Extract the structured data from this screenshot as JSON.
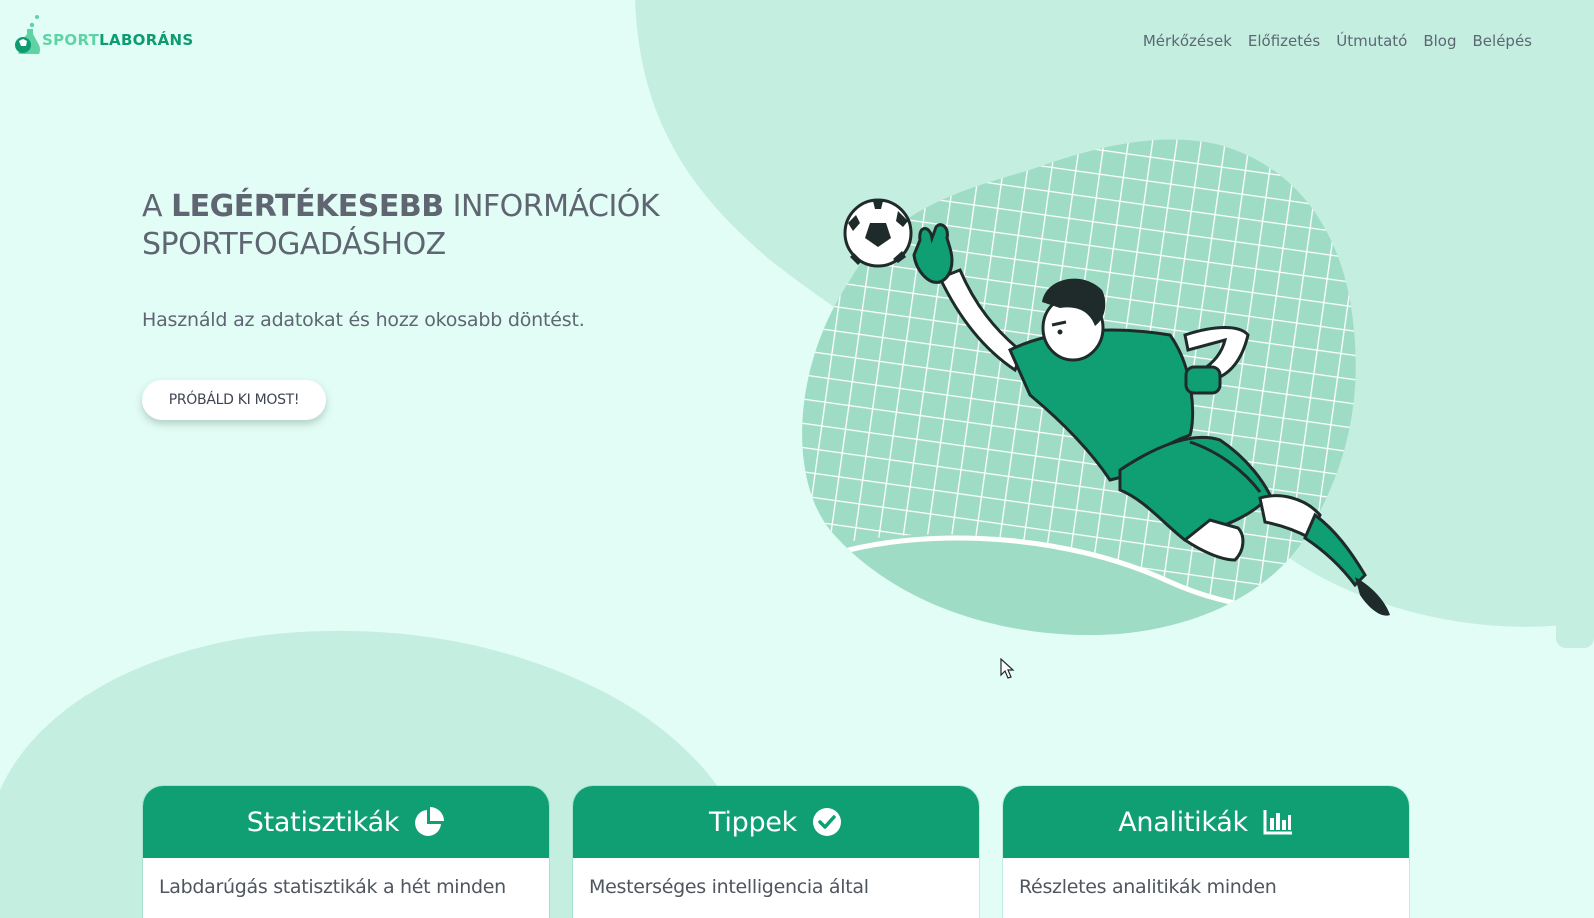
{
  "brand": {
    "logo_part1": "SPORT",
    "logo_part2": "LABORÁNS",
    "accent": "#0f9f73",
    "accent_light": "#5fd3a6",
    "background": "#e2fdf5"
  },
  "nav": {
    "items": [
      {
        "label": "Mérkőzések"
      },
      {
        "label": "Előfizetés"
      },
      {
        "label": "Útmutató"
      },
      {
        "label": "Blog"
      },
      {
        "label": "Belépés"
      }
    ]
  },
  "hero": {
    "title_pre": "A ",
    "title_strong": "LEGÉRTÉKESEBB",
    "title_post": " INFORMÁCIÓK",
    "title_line2": "SPORTFOGADÁSHOZ",
    "subtitle": "Használd az adatokat és hozz okosabb döntést.",
    "cta_label": "PRÓBÁLD KI MOST!"
  },
  "features": [
    {
      "title": "Statisztikák",
      "icon": "pie-chart-icon",
      "text": "Labdarúgás statisztikák a hét minden"
    },
    {
      "title": "Tippek",
      "icon": "check-circle-icon",
      "text": "Mesterséges intelligencia által"
    },
    {
      "title": "Analitikák",
      "icon": "bar-chart-icon",
      "text": "Részletes analitikák minden"
    }
  ]
}
